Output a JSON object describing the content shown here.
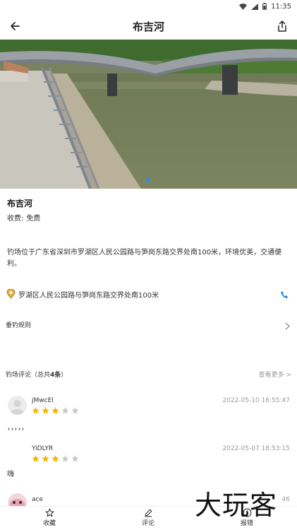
{
  "status_bar": {
    "time": "11:35"
  },
  "header": {
    "title": "布吉河"
  },
  "spot": {
    "name": "布吉河",
    "fee_label": "收费:",
    "fee_value": "免费",
    "description": "钓场位于广东省深圳市罗湖区人民公园路与笋岗东路交界处南100米，环境优美，交通便利。",
    "address": "罗湖区人民公园路与笋岗东路交界处南100米"
  },
  "rules": {
    "label": "垂钓规则"
  },
  "reviews": {
    "title_prefix": "钓场评论（总共",
    "count": "4条",
    "title_suffix": "）",
    "more": "查看更多 >",
    "items": [
      {
        "user": "jMwcEl",
        "rating": 3,
        "date": "2022-05-10 16:55:47",
        "text": "，，，，，"
      },
      {
        "user": "YiDLYR",
        "rating": 3,
        "date": "2022-05-07 18:53:15",
        "text": "嗨"
      },
      {
        "user": "ace",
        "rating": 0,
        "date": "46",
        "text": ""
      }
    ]
  },
  "bottom_bar": {
    "favorite": "收藏",
    "comment": "评论",
    "report": "报错"
  },
  "watermark": "大玩客",
  "colors": {
    "accent": "#2f8be3",
    "star_on": "#f5b400",
    "star_off": "#c9c9c9"
  }
}
